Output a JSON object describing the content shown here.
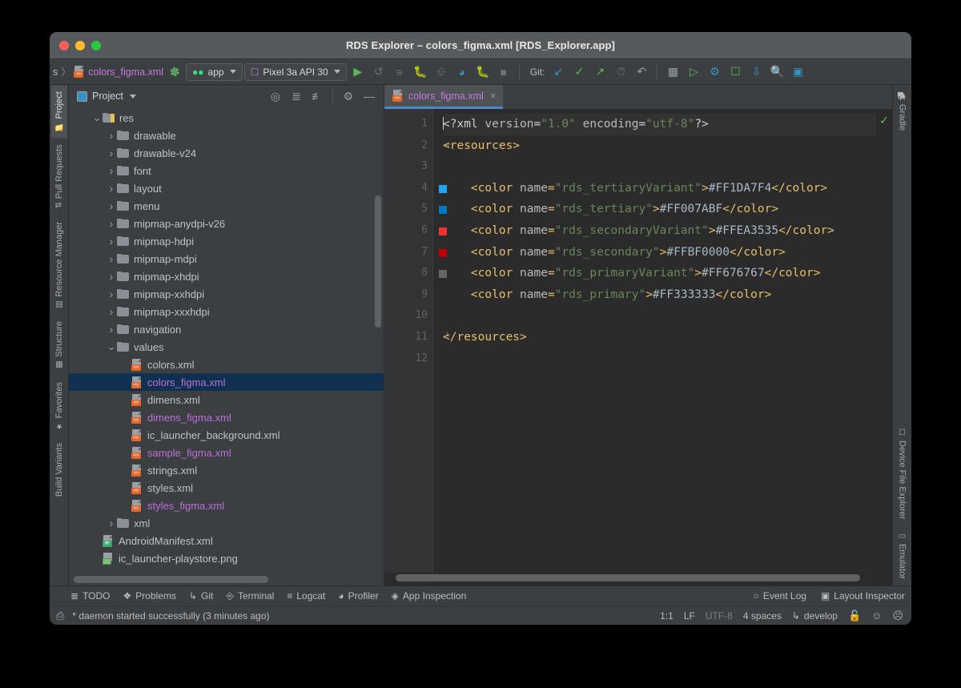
{
  "window": {
    "title": "RDS Explorer – colors_figma.xml [RDS_Explorer.app]",
    "traffic": {
      "close": "close-button",
      "minimize": "minimize-button",
      "zoom": "zoom-button"
    }
  },
  "toolbar": {
    "breadcrumb_prefix": "s",
    "breadcrumb_separator": "〉",
    "breadcrumb_file": "colors_figma.xml",
    "build_label": "build-hammer",
    "app_config": "app",
    "device": "Pixel 3a API 30",
    "git_label": "Git:",
    "icons": [
      "run-icon",
      "apply-changes-icon",
      "apply-code-changes-icon",
      "debug-icon",
      "attach-debugger-icon",
      "profiler-icon",
      "debug-attach-icon",
      "stop-icon"
    ],
    "git_icons": [
      "update-project-icon",
      "commit-icon",
      "push-icon",
      "history-icon",
      "revert-icon"
    ],
    "right_icons": [
      "project-structure-icon",
      "avd-manager-icon",
      "sdk-manager-icon",
      "device-manager-icon",
      "sync-gradle-icon",
      "search-icon",
      "layout-editor-icon"
    ]
  },
  "left_stripe": [
    {
      "label": "Project",
      "icon": "project-icon",
      "active": true
    },
    {
      "label": "Pull Requests",
      "icon": "pull-requests-icon",
      "active": false
    },
    {
      "label": "Resource Manager",
      "icon": "resource-manager-icon",
      "active": false
    },
    {
      "label": "Structure",
      "icon": "structure-icon",
      "active": false
    },
    {
      "label": "Favorites",
      "icon": "favorites-star-icon",
      "active": false
    },
    {
      "label": "Build Variants",
      "icon": "build-variants-icon",
      "active": false
    }
  ],
  "right_stripe_top": [
    {
      "label": "Gradle",
      "icon": "gradle-elephant-icon"
    }
  ],
  "right_stripe_bottom": [
    {
      "label": "Device File Explorer",
      "icon": "device-file-explorer-icon"
    },
    {
      "label": "Emulator",
      "icon": "emulator-icon"
    }
  ],
  "project_panel": {
    "title": "Project",
    "view_caret": "chevron-down-icon",
    "header_icons": [
      "locate-file-icon",
      "expand-all-icon",
      "collapse-all-icon",
      "settings-gear-icon",
      "hide-panel-icon"
    ],
    "tree": [
      {
        "label": "res",
        "type": "folder-res",
        "indent": 1,
        "arrow": "down",
        "selected": false,
        "color": "normal"
      },
      {
        "label": "drawable",
        "type": "folder",
        "indent": 2,
        "arrow": "right",
        "selected": false,
        "color": "normal"
      },
      {
        "label": "drawable-v24",
        "type": "folder",
        "indent": 2,
        "arrow": "right",
        "selected": false,
        "color": "normal"
      },
      {
        "label": "font",
        "type": "folder",
        "indent": 2,
        "arrow": "right",
        "selected": false,
        "color": "normal"
      },
      {
        "label": "layout",
        "type": "folder",
        "indent": 2,
        "arrow": "right",
        "selected": false,
        "color": "normal"
      },
      {
        "label": "menu",
        "type": "folder",
        "indent": 2,
        "arrow": "right",
        "selected": false,
        "color": "normal"
      },
      {
        "label": "mipmap-anydpi-v26",
        "type": "folder",
        "indent": 2,
        "arrow": "right",
        "selected": false,
        "color": "normal"
      },
      {
        "label": "mipmap-hdpi",
        "type": "folder",
        "indent": 2,
        "arrow": "right",
        "selected": false,
        "color": "normal"
      },
      {
        "label": "mipmap-mdpi",
        "type": "folder",
        "indent": 2,
        "arrow": "right",
        "selected": false,
        "color": "normal"
      },
      {
        "label": "mipmap-xhdpi",
        "type": "folder",
        "indent": 2,
        "arrow": "right",
        "selected": false,
        "color": "normal"
      },
      {
        "label": "mipmap-xxhdpi",
        "type": "folder",
        "indent": 2,
        "arrow": "right",
        "selected": false,
        "color": "normal"
      },
      {
        "label": "mipmap-xxxhdpi",
        "type": "folder",
        "indent": 2,
        "arrow": "right",
        "selected": false,
        "color": "normal"
      },
      {
        "label": "navigation",
        "type": "folder",
        "indent": 2,
        "arrow": "right",
        "selected": false,
        "color": "normal"
      },
      {
        "label": "values",
        "type": "folder",
        "indent": 2,
        "arrow": "down",
        "selected": false,
        "color": "normal"
      },
      {
        "label": "colors.xml",
        "type": "xml",
        "indent": 3,
        "arrow": "none",
        "selected": false,
        "color": "normal"
      },
      {
        "label": "colors_figma.xml",
        "type": "xml",
        "indent": 3,
        "arrow": "none",
        "selected": true,
        "color": "purple"
      },
      {
        "label": "dimens.xml",
        "type": "xml",
        "indent": 3,
        "arrow": "none",
        "selected": false,
        "color": "normal"
      },
      {
        "label": "dimens_figma.xml",
        "type": "xml",
        "indent": 3,
        "arrow": "none",
        "selected": false,
        "color": "purple"
      },
      {
        "label": "ic_launcher_background.xml",
        "type": "xml",
        "indent": 3,
        "arrow": "none",
        "selected": false,
        "color": "normal"
      },
      {
        "label": "sample_figma.xml",
        "type": "xml",
        "indent": 3,
        "arrow": "none",
        "selected": false,
        "color": "purple"
      },
      {
        "label": "strings.xml",
        "type": "xml",
        "indent": 3,
        "arrow": "none",
        "selected": false,
        "color": "normal"
      },
      {
        "label": "styles.xml",
        "type": "xml",
        "indent": 3,
        "arrow": "none",
        "selected": false,
        "color": "normal"
      },
      {
        "label": "styles_figma.xml",
        "type": "xml",
        "indent": 3,
        "arrow": "none",
        "selected": false,
        "color": "purple"
      },
      {
        "label": "xml",
        "type": "folder",
        "indent": 2,
        "arrow": "right",
        "selected": false,
        "color": "normal"
      },
      {
        "label": "AndroidManifest.xml",
        "type": "manifest",
        "indent": 1,
        "arrow": "none",
        "selected": false,
        "color": "normal"
      },
      {
        "label": "ic_launcher-playstore.png",
        "type": "png",
        "indent": 1,
        "arrow": "none",
        "selected": false,
        "color": "normal"
      }
    ]
  },
  "editor": {
    "tab": {
      "label": "colors_figma.xml",
      "close": "×",
      "icon": "xml-file-icon"
    },
    "inspection_status": "ok-check-icon",
    "lines": [
      {
        "n": "1",
        "swatch": null,
        "fold": null,
        "highlight": true,
        "tokens": [
          {
            "t": "<?xml ",
            "c": "t-white"
          },
          {
            "t": "version",
            "c": "t-attrname"
          },
          {
            "t": "=",
            "c": "t-white"
          },
          {
            "t": "\"1.0\"",
            "c": "t-str"
          },
          {
            "t": " encoding",
            "c": "t-attrname"
          },
          {
            "t": "=",
            "c": "t-white"
          },
          {
            "t": "\"utf-8\"",
            "c": "t-str"
          },
          {
            "t": "?>",
            "c": "t-white"
          }
        ]
      },
      {
        "n": "2",
        "swatch": null,
        "fold": "minus",
        "highlight": false,
        "tokens": [
          {
            "t": "<resources>",
            "c": "t-bracket"
          }
        ]
      },
      {
        "n": "3",
        "swatch": null,
        "fold": null,
        "highlight": false,
        "tokens": []
      },
      {
        "n": "4",
        "swatch": "#1DA7F4",
        "fold": null,
        "highlight": false,
        "tokens": [
          {
            "t": "    <color ",
            "c": "t-bracket"
          },
          {
            "t": "name",
            "c": "t-attrname"
          },
          {
            "t": "=",
            "c": "t-bracket"
          },
          {
            "t": "\"rds_tertiaryVariant\"",
            "c": "t-str"
          },
          {
            "t": ">",
            "c": "t-bracket"
          },
          {
            "t": "#FF1DA7F4",
            "c": "t-text"
          },
          {
            "t": "</color>",
            "c": "t-bracket"
          }
        ]
      },
      {
        "n": "5",
        "swatch": "#007ABF",
        "fold": null,
        "highlight": false,
        "tokens": [
          {
            "t": "    <color ",
            "c": "t-bracket"
          },
          {
            "t": "name",
            "c": "t-attrname"
          },
          {
            "t": "=",
            "c": "t-bracket"
          },
          {
            "t": "\"rds_tertiary\"",
            "c": "t-str"
          },
          {
            "t": ">",
            "c": "t-bracket"
          },
          {
            "t": "#FF007ABF",
            "c": "t-text"
          },
          {
            "t": "</color>",
            "c": "t-bracket"
          }
        ]
      },
      {
        "n": "6",
        "swatch": "#EA3535",
        "fold": null,
        "highlight": false,
        "tokens": [
          {
            "t": "    <color ",
            "c": "t-bracket"
          },
          {
            "t": "name",
            "c": "t-attrname"
          },
          {
            "t": "=",
            "c": "t-bracket"
          },
          {
            "t": "\"rds_secondaryVariant\"",
            "c": "t-str"
          },
          {
            "t": ">",
            "c": "t-bracket"
          },
          {
            "t": "#FFEA3535",
            "c": "t-text"
          },
          {
            "t": "</color>",
            "c": "t-bracket"
          }
        ]
      },
      {
        "n": "7",
        "swatch": "#BF0000",
        "fold": null,
        "highlight": false,
        "tokens": [
          {
            "t": "    <color ",
            "c": "t-bracket"
          },
          {
            "t": "name",
            "c": "t-attrname"
          },
          {
            "t": "=",
            "c": "t-bracket"
          },
          {
            "t": "\"rds_secondary\"",
            "c": "t-str"
          },
          {
            "t": ">",
            "c": "t-bracket"
          },
          {
            "t": "#FFBF0000",
            "c": "t-text"
          },
          {
            "t": "</color>",
            "c": "t-bracket"
          }
        ]
      },
      {
        "n": "8",
        "swatch": "#676767",
        "fold": null,
        "highlight": false,
        "tokens": [
          {
            "t": "    <color ",
            "c": "t-bracket"
          },
          {
            "t": "name",
            "c": "t-attrname"
          },
          {
            "t": "=",
            "c": "t-bracket"
          },
          {
            "t": "\"rds_primaryVariant\"",
            "c": "t-str"
          },
          {
            "t": ">",
            "c": "t-bracket"
          },
          {
            "t": "#FF676767",
            "c": "t-text"
          },
          {
            "t": "</color>",
            "c": "t-bracket"
          }
        ]
      },
      {
        "n": "9",
        "swatch": null,
        "fold": null,
        "highlight": false,
        "tokens": [
          {
            "t": "    <color ",
            "c": "t-bracket"
          },
          {
            "t": "name",
            "c": "t-attrname"
          },
          {
            "t": "=",
            "c": "t-bracket"
          },
          {
            "t": "\"rds_primary\"",
            "c": "t-str"
          },
          {
            "t": ">",
            "c": "t-bracket"
          },
          {
            "t": "#FF333333",
            "c": "t-text"
          },
          {
            "t": "</color>",
            "c": "t-bracket"
          }
        ]
      },
      {
        "n": "10",
        "swatch": null,
        "fold": null,
        "highlight": false,
        "tokens": []
      },
      {
        "n": "11",
        "swatch": null,
        "fold": "end",
        "highlight": false,
        "tokens": [
          {
            "t": "</resources>",
            "c": "t-bracket"
          }
        ]
      },
      {
        "n": "12",
        "swatch": null,
        "fold": null,
        "highlight": false,
        "tokens": []
      }
    ]
  },
  "bottom_bar": {
    "items": [
      {
        "label": "TODO",
        "icon": "todo-icon"
      },
      {
        "label": "Problems",
        "icon": "problems-icon"
      },
      {
        "label": "Git",
        "icon": "git-branch-icon"
      },
      {
        "label": "Terminal",
        "icon": "terminal-icon"
      },
      {
        "label": "Logcat",
        "icon": "logcat-icon"
      },
      {
        "label": "Profiler",
        "icon": "profiler-gauge-icon"
      },
      {
        "label": "App Inspection",
        "icon": "app-inspection-icon"
      }
    ],
    "right_items": [
      {
        "label": "Event Log",
        "icon": "event-log-icon"
      },
      {
        "label": "Layout Inspector",
        "icon": "layout-inspector-icon"
      }
    ]
  },
  "status_bar": {
    "message": "* daemon started successfully (3 minutes ago)",
    "message_icon": "toggle-toolwindow-icon",
    "caret_position": "1:1",
    "line_separator": "LF",
    "encoding": "UTF-8",
    "indent": "4 spaces",
    "branch": "develop",
    "branch_icon": "git-branch-icon",
    "lock_icon": "unlocked-icon",
    "happy_icon": "happy-face-icon",
    "sad_icon": "sad-face-icon"
  }
}
